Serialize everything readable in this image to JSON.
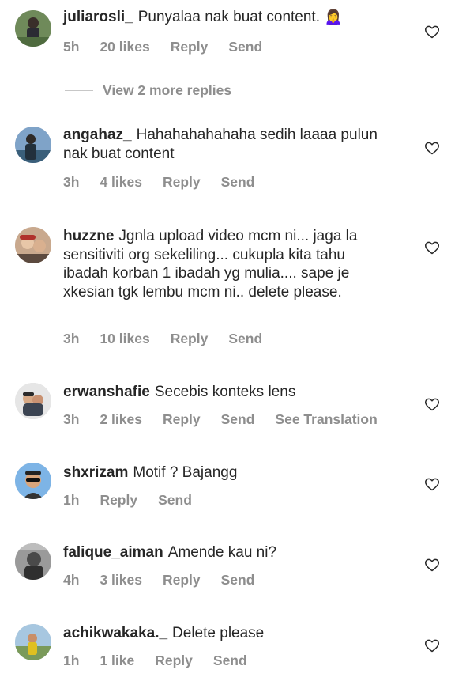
{
  "comments": [
    {
      "username": "juliarosli_",
      "text": "Punyalaa nak buat content.",
      "emoji": "🙍‍♀️",
      "time": "5h",
      "likes": "20 likes",
      "reply": "Reply",
      "send": "Send"
    },
    {
      "username": "angahaz_",
      "text": "Hahahahahahaha sedih laaaa pulun nak buat content",
      "time": "3h",
      "likes": "4 likes",
      "reply": "Reply",
      "send": "Send"
    },
    {
      "username": "huzzne",
      "text": "Jgnla upload video mcm ni... jaga la sensitiviti org sekeliling... cukupla kita tahu ibadah korban 1 ibadah yg mulia.... sape je xkesian tgk lembu mcm ni.. delete please.",
      "time": "3h",
      "likes": "10 likes",
      "reply": "Reply",
      "send": "Send"
    },
    {
      "username": "erwanshafie",
      "text": "Secebis konteks lens",
      "time": "3h",
      "likes": "2 likes",
      "reply": "Reply",
      "send": "Send",
      "translate": "See Translation"
    },
    {
      "username": "shxrizam",
      "text": "Motif ? Bajangg",
      "time": "1h",
      "reply": "Reply",
      "send": "Send"
    },
    {
      "username": "falique_aiman",
      "text": "Amende kau ni?",
      "time": "4h",
      "likes": "3 likes",
      "reply": "Reply",
      "send": "Send"
    },
    {
      "username": "achikwakaka._",
      "text": "Delete please",
      "time": "1h",
      "likes": "1 like",
      "reply": "Reply",
      "send": "Send"
    }
  ],
  "view_replies": "View 2 more replies",
  "icons": {
    "like": "heart-outline-icon"
  },
  "colors": {
    "text": "#262626",
    "meta": "#8e8e8e"
  }
}
